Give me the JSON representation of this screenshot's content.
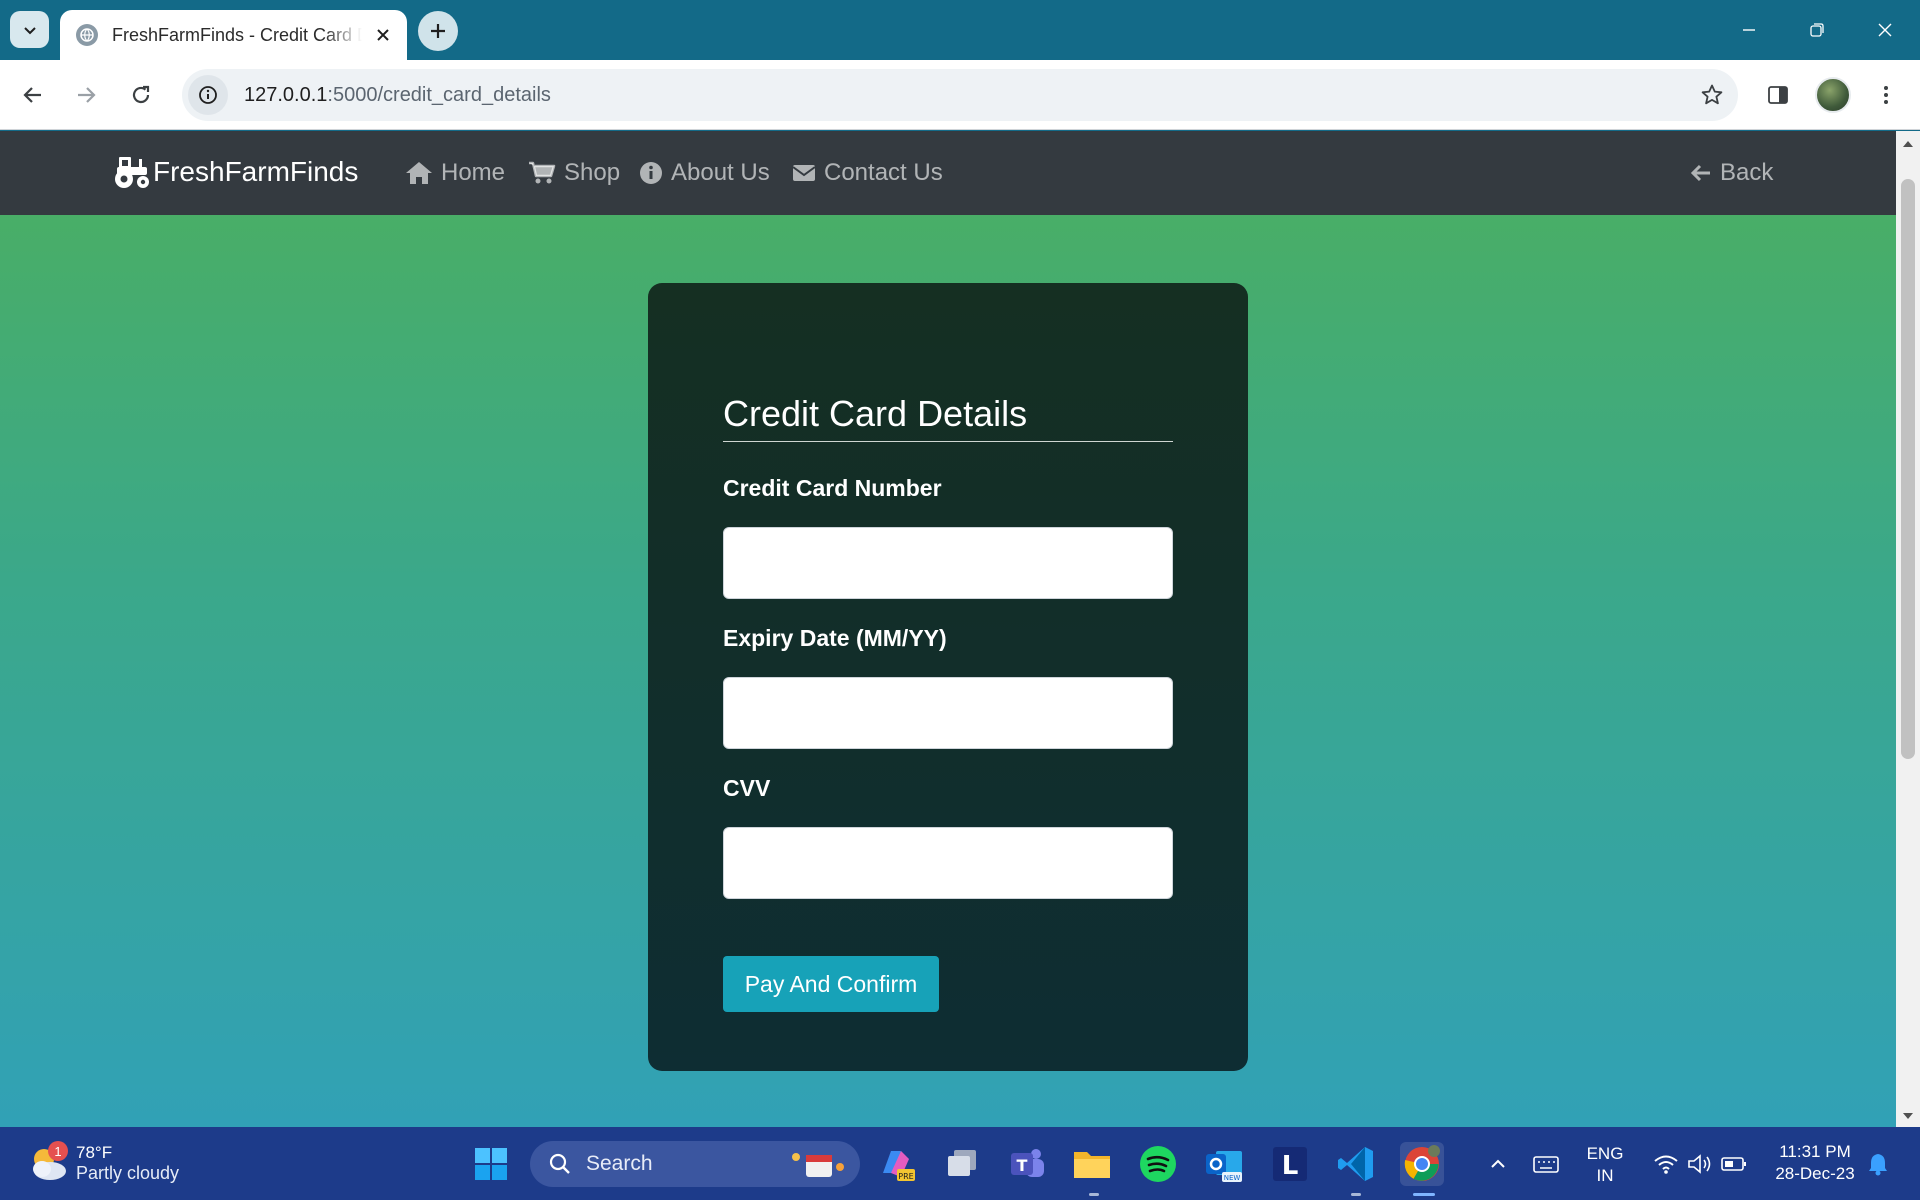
{
  "browser": {
    "tab_title": "FreshFarmFinds - Credit Card Details",
    "url_host": "127.0.0.1",
    "url_path": ":5000/credit_card_details"
  },
  "navbar": {
    "brand": "FreshFarmFinds",
    "links": [
      {
        "label": "Home",
        "icon": "home-icon"
      },
      {
        "label": "Shop",
        "icon": "cart-icon"
      },
      {
        "label": "About Us",
        "icon": "info-icon"
      },
      {
        "label": "Contact Us",
        "icon": "envelope-icon"
      }
    ],
    "back_label": "Back"
  },
  "form": {
    "title": "Credit Card Details",
    "card_number_label": "Credit Card Number",
    "card_number_value": "",
    "expiry_label": "Expiry Date (MM/YY)",
    "expiry_value": "",
    "cvv_label": "CVV",
    "cvv_value": "",
    "submit_label": "Pay And Confirm"
  },
  "taskbar": {
    "weather_temp": "78°F",
    "weather_desc": "Partly cloudy",
    "weather_badge": "1",
    "search_placeholder": "Search",
    "lang_line1": "ENG",
    "lang_line2": "IN",
    "time": "11:31 PM",
    "date": "28-Dec-23"
  },
  "colors": {
    "navbar_bg": "#343a40",
    "card_bg": "#152f22",
    "button_bg": "#17a2b8",
    "page_gradient_top": "#4caf5f",
    "page_gradient_bottom": "#31a1b6",
    "chrome_bg": "#136a88",
    "taskbar_bg": "#1d3b8a"
  }
}
